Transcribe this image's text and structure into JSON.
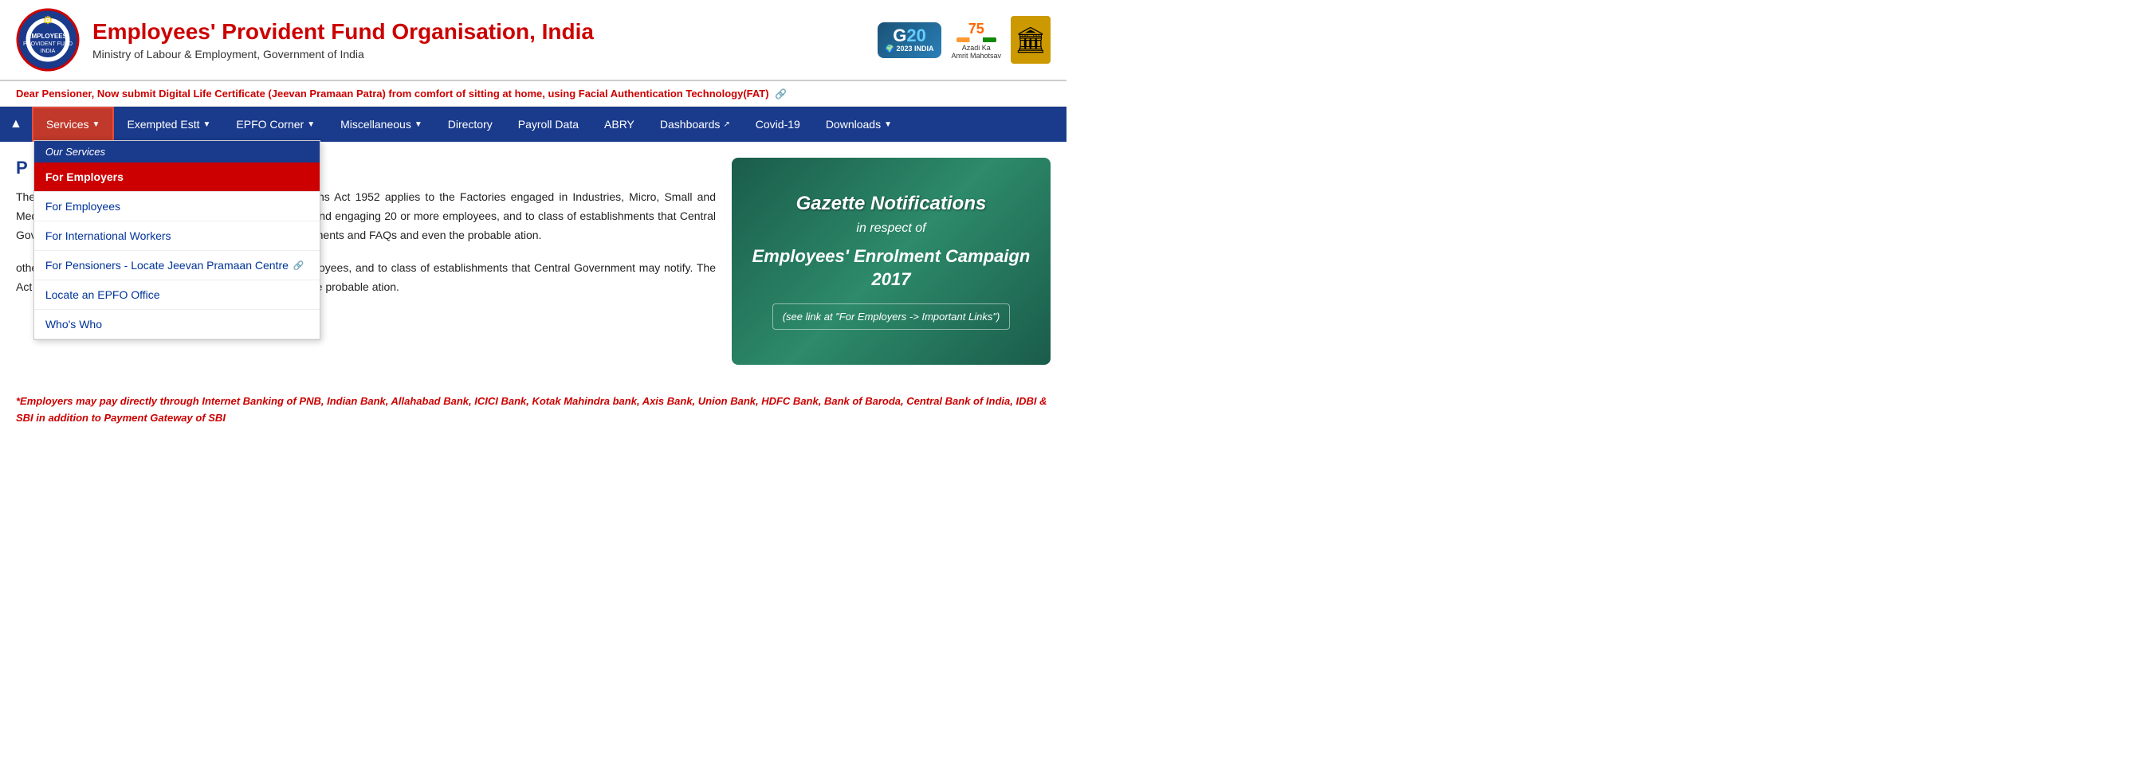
{
  "header": {
    "main_title": "Employees' Provident Fund Organisation, India",
    "subtitle": "Ministry of Labour & Employment, Government of India",
    "emblem_char": "🏛"
  },
  "ticker": {
    "text": "Dear Pensioner, Now submit Digital Life Certificate (Jeevan Pramaan Patra) from comfort of sitting at home, using Facial Authentication Technology(FAT)"
  },
  "navbar": {
    "home_icon": "▲",
    "items": [
      {
        "id": "services",
        "label": "Services",
        "has_arrow": true,
        "active": true
      },
      {
        "id": "exempted",
        "label": "Exempted Estt",
        "has_arrow": true
      },
      {
        "id": "epfo",
        "label": "EPFO Corner",
        "has_arrow": true
      },
      {
        "id": "misc",
        "label": "Miscellaneous",
        "has_arrow": true
      },
      {
        "id": "directory",
        "label": "Directory",
        "has_arrow": false
      },
      {
        "id": "payroll",
        "label": "Payroll Data",
        "has_arrow": false
      },
      {
        "id": "abry",
        "label": "ABRY",
        "has_arrow": false
      },
      {
        "id": "dashboards",
        "label": "Dashboards",
        "has_arrow": false,
        "external": true
      },
      {
        "id": "covid",
        "label": "Covid-19",
        "has_arrow": false
      },
      {
        "id": "downloads",
        "label": "Downloads",
        "has_arrow": true
      }
    ]
  },
  "dropdown": {
    "header": "Our Services",
    "items": [
      {
        "id": "for-employers",
        "label": "For Employers",
        "selected": true,
        "external": false
      },
      {
        "id": "for-employees",
        "label": "For Employees",
        "selected": false,
        "external": false
      },
      {
        "id": "for-international",
        "label": "For International Workers",
        "selected": false,
        "external": false
      },
      {
        "id": "for-pensioners",
        "label": "For Pensioners - Locate Jeevan Pramaan Centre",
        "selected": false,
        "external": true
      },
      {
        "id": "locate-office",
        "label": "Locate an EPFO Office",
        "selected": false,
        "external": false
      },
      {
        "id": "whos-who",
        "label": "Who's Who",
        "selected": false,
        "external": false
      }
    ]
  },
  "main": {
    "page_title": "P",
    "paragraph1": "The Employees' Provident Funds & Miscellaneous Provisions Act 1952 applies to the Factories engaged in Industries, Micro, Small and Medium Enterprises (MSME), other establishments notified and engaging 20 or more employees, and to class of establishments that Central Government may notify. The Act provides for",
    "paragraph2": "other establishments notified and engaging 20 or more employees, and to class of establishments that Central Government may notify. The Act provides for illustrated documents and FAQs and even the probable ation."
  },
  "gazette": {
    "title": "Gazette Notifications",
    "subtitle": "in respect of",
    "campaign": "Employees' Enrolment Campaign 2017",
    "note": "(see link at \"For Employers -> Important Links\")"
  },
  "bottom_notice": {
    "text": "*Employers may pay directly through Internet Banking of PNB, Indian Bank, Allahabad Bank, ICICI Bank, Kotak Mahindra bank, Axis Bank, Union Bank, HDFC Bank, Bank of Baroda, Central Bank of India, IDBI & SBI in addition to Payment Gateway of SBI"
  }
}
